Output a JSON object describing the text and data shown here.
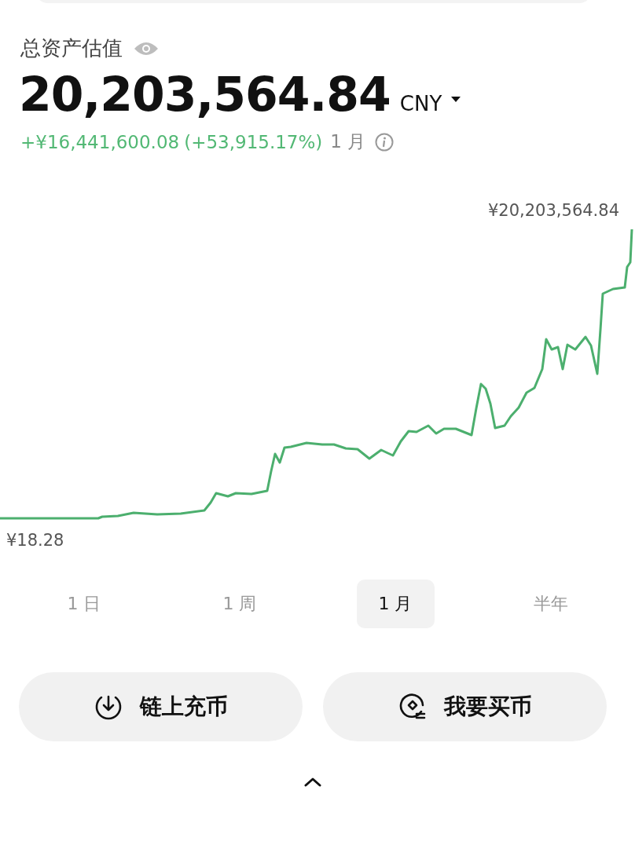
{
  "total_assets": {
    "label": "总资产估值",
    "value": "20,203,564.84",
    "currency": "CNY"
  },
  "change": {
    "amount": "+¥16,441,600.08",
    "percent": "(+53,915.17%)",
    "period": "1 月"
  },
  "chart": {
    "max_label": "¥20,203,564.84",
    "min_label": "¥18.28"
  },
  "period_tabs": [
    {
      "label": "1 日",
      "selected": false
    },
    {
      "label": "1 周",
      "selected": false
    },
    {
      "label": "1 月",
      "selected": true
    },
    {
      "label": "半年",
      "selected": false
    }
  ],
  "actions": [
    {
      "kind": "deposit",
      "label": "链上充币"
    },
    {
      "kind": "buy",
      "label": "我要买币"
    }
  ]
}
